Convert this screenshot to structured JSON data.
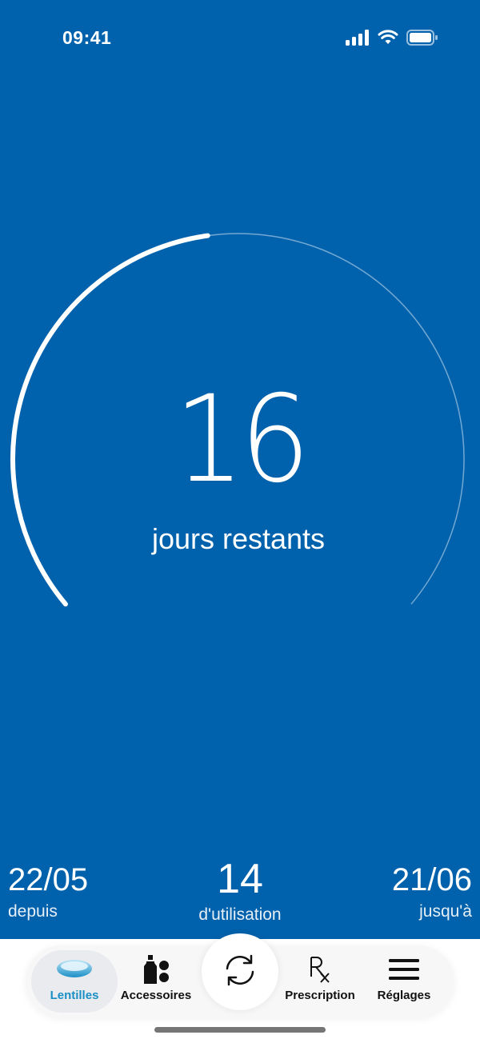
{
  "status_bar": {
    "time": "09:41",
    "icons": [
      "cellular-signal-icon",
      "wifi-icon",
      "battery-icon"
    ]
  },
  "lens_counter": {
    "days_remaining": "16",
    "days_remaining_label": "jours restants",
    "progress_fraction_used": 0.47
  },
  "stats": {
    "since": {
      "value": "22/05",
      "label": "depuis"
    },
    "usage": {
      "value": "14",
      "label": "d'utilisation"
    },
    "until": {
      "value": "21/06",
      "label": "jusqu'à"
    }
  },
  "tabbar": {
    "tabs": [
      {
        "label": "Lentilles",
        "icon": "contact-lens-icon",
        "active": true
      },
      {
        "label": "Accessoires",
        "icon": "accessories-bottle-icon",
        "active": false
      },
      {
        "label": "Prescription",
        "icon": "prescription-rx-icon",
        "active": false
      },
      {
        "label": "Réglages",
        "icon": "menu-icon",
        "active": false
      }
    ],
    "center_action_icon": "refresh-icon"
  },
  "colors": {
    "background": "#0062ad",
    "accent": "#1a8fc6",
    "text": "#ffffff"
  }
}
